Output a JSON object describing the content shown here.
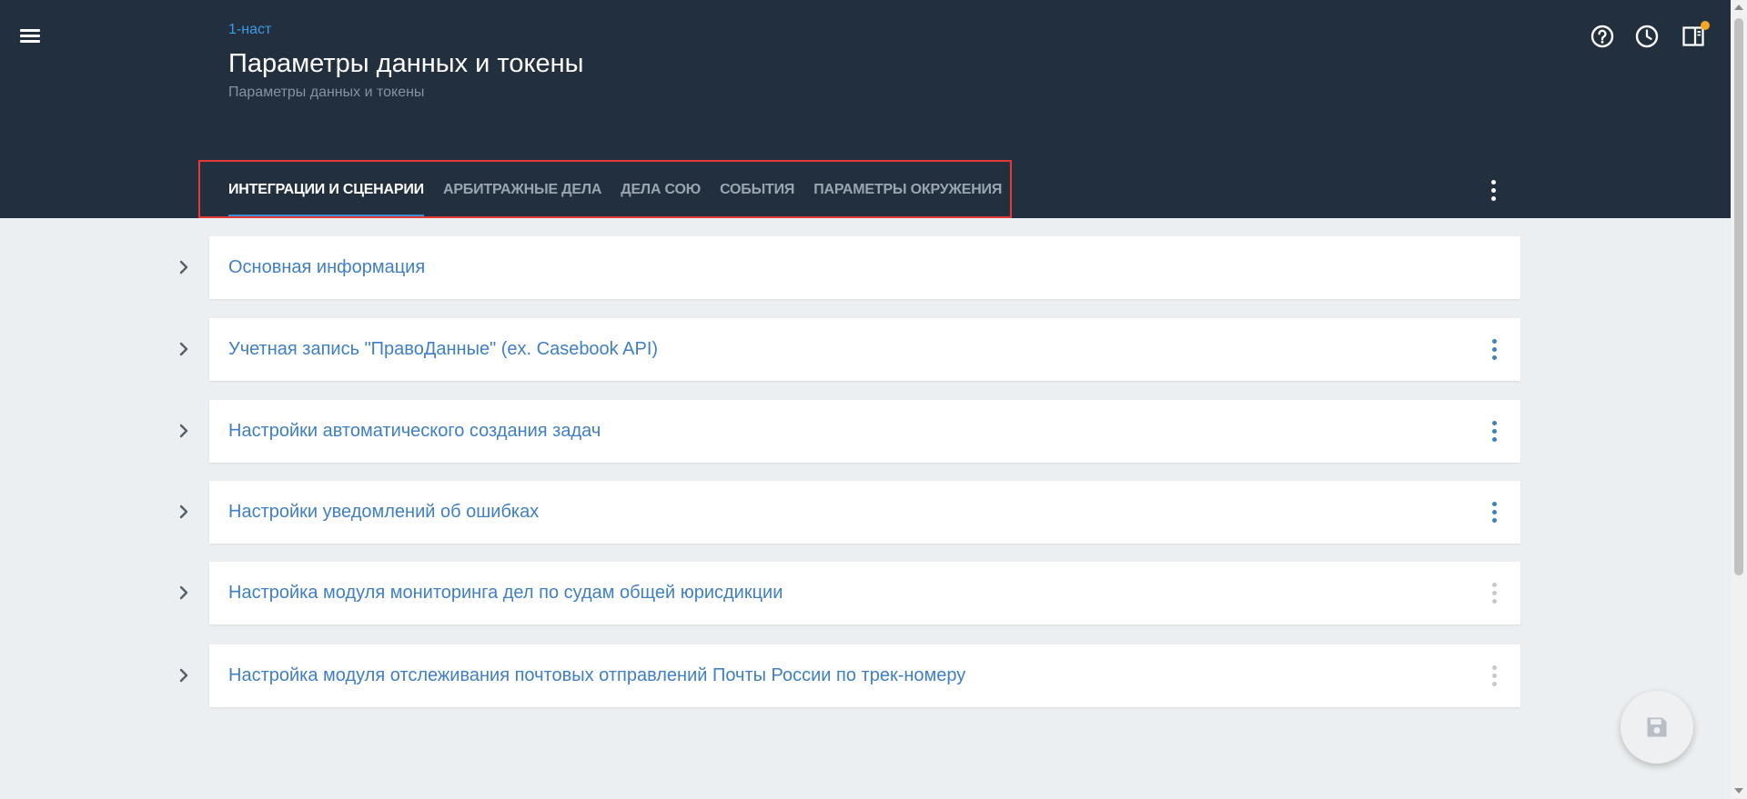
{
  "app": {
    "menu_icon": "hamburger-icon"
  },
  "header": {
    "breadcrumb": "1-наст",
    "title": "Параметры данных и токены",
    "subtitle": "Параметры данных и токены",
    "actions": [
      {
        "name": "help",
        "icon": "help-circle-icon"
      },
      {
        "name": "history",
        "icon": "clock-icon"
      },
      {
        "name": "side-panel",
        "icon": "side-panel-icon",
        "has_notification": true
      }
    ]
  },
  "tabs": [
    {
      "label": "ИНТЕГРАЦИИ И СЦЕНАРИИ",
      "active": true
    },
    {
      "label": "АРБИТРАЖНЫЕ ДЕЛА",
      "active": false
    },
    {
      "label": "ДЕЛА СОЮ",
      "active": false
    },
    {
      "label": "СОБЫТИЯ",
      "active": false
    },
    {
      "label": "ПАРАМЕТРЫ ОКРУЖЕНИЯ",
      "active": false
    }
  ],
  "tabs_menu_icon": "more-vert-icon",
  "sections": [
    {
      "title": "Основная информация",
      "expanded": false,
      "menu": "none"
    },
    {
      "title": "Учетная запись \"ПравоДанные\" (ex. Casebook API)",
      "expanded": false,
      "menu": "enabled"
    },
    {
      "title": "Настройки автоматического создания задач",
      "expanded": false,
      "menu": "enabled"
    },
    {
      "title": "Настройки уведомлений об ошибках",
      "expanded": false,
      "menu": "enabled"
    },
    {
      "title": "Настройка модуля мониторинга дел по судам общей юрисдикции",
      "expanded": false,
      "menu": "disabled"
    },
    {
      "title": "Настройка модуля отслеживания почтовых отправлений Почты России по трек-номеру",
      "expanded": false,
      "menu": "disabled"
    }
  ],
  "fab": {
    "icon": "save-icon",
    "enabled": false
  },
  "colors": {
    "header_bg": "#222f3e",
    "accent": "#3d8fd8",
    "link": "#3f7fc4",
    "page_bg": "#eceff1",
    "highlight": "#e53935",
    "notification": "#f5a623"
  }
}
